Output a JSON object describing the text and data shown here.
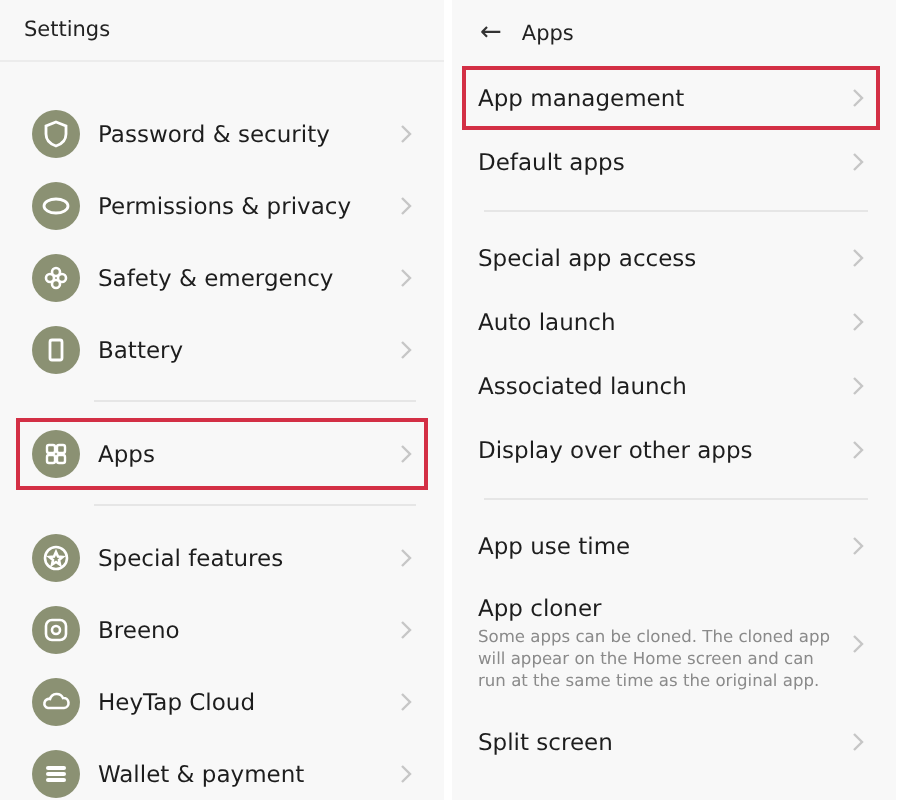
{
  "settings": {
    "title": "Settings",
    "groups": [
      [
        {
          "label": "Password & security",
          "highlighted": false
        },
        {
          "label": "Permissions & privacy",
          "highlighted": false
        },
        {
          "label": "Safety & emergency",
          "highlighted": false
        },
        {
          "label": "Battery",
          "highlighted": false
        }
      ],
      [
        {
          "label": "Apps",
          "highlighted": true
        }
      ],
      [
        {
          "label": "Special features",
          "highlighted": false
        },
        {
          "label": "Breeno",
          "highlighted": false
        },
        {
          "label": "HeyTap Cloud",
          "highlighted": false
        },
        {
          "label": "Wallet & payment",
          "highlighted": false
        }
      ]
    ]
  },
  "apps": {
    "back": "←",
    "title": "Apps",
    "groups": [
      [
        {
          "label": "App management",
          "highlighted": true
        },
        {
          "label": "Default apps",
          "highlighted": false
        }
      ],
      [
        {
          "label": "Special app access",
          "highlighted": false
        },
        {
          "label": "Auto launch",
          "highlighted": false
        },
        {
          "label": "Associated launch",
          "highlighted": false
        },
        {
          "label": "Display over other apps",
          "highlighted": false
        }
      ],
      [
        {
          "label": "App use time",
          "highlighted": false
        },
        {
          "label": "App cloner",
          "description": "Some apps can be cloned. The cloned app will appear on the Home screen and can run at the same time as the original app.",
          "highlighted": false
        },
        {
          "label": "Split screen",
          "highlighted": false
        }
      ]
    ]
  }
}
